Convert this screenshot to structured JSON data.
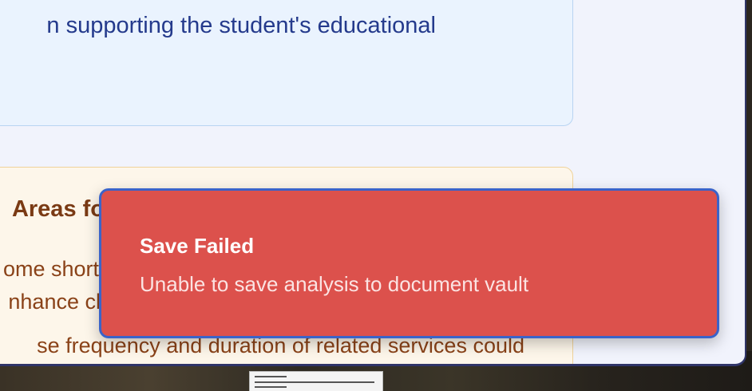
{
  "analysis_card": {
    "text": "n supporting the student's educational"
  },
  "areas_card": {
    "heading": "Areas fo",
    "lines": [
      "ome short",
      "nhance cla",
      "se frequency and duration of related services could"
    ]
  },
  "toast": {
    "title": "Save Failed",
    "message": "Unable to save analysis to document vault",
    "type": "error"
  },
  "colors": {
    "toast_bg": "#dc514c",
    "toast_border": "#3a63c9",
    "card_blue_bg": "#eaf3fe",
    "card_orange_bg": "#fdf6ea"
  }
}
